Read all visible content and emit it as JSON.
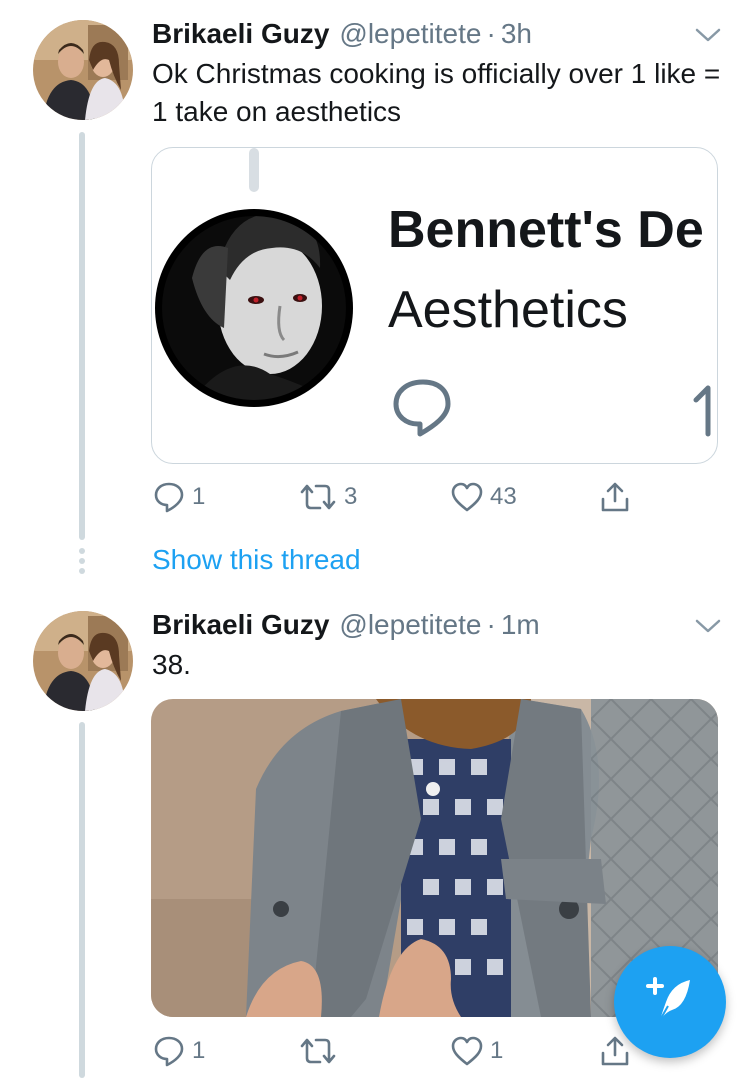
{
  "tweets": [
    {
      "name": "Brikaeli Guzy",
      "handle": "@lepetitete",
      "separator": "·",
      "time": "3h",
      "text": "Ok Christmas cooking is officially over 1 like = 1 take on aesthetics",
      "embedded": {
        "title": "Bennett's De",
        "subtitle": "Aesthetics"
      },
      "actions": {
        "replies": "1",
        "retweets": "3",
        "likes": "43"
      },
      "show_thread": "Show this thread"
    },
    {
      "name": "Brikaeli Guzy",
      "handle": "@lepetitete",
      "separator": "·",
      "time": "1m",
      "text": "38.",
      "actions": {
        "replies": "1",
        "retweets": "",
        "likes": "1"
      }
    }
  ],
  "icons": {
    "reply": "reply-icon",
    "retweet": "retweet-icon",
    "like": "heart-icon",
    "share": "share-icon",
    "caret": "chevron-down-icon",
    "compose": "compose-tweet-icon"
  },
  "colors": {
    "accent": "#1da1f2",
    "muted": "#657786",
    "text": "#14171a",
    "thread_line": "#cfd9de"
  }
}
